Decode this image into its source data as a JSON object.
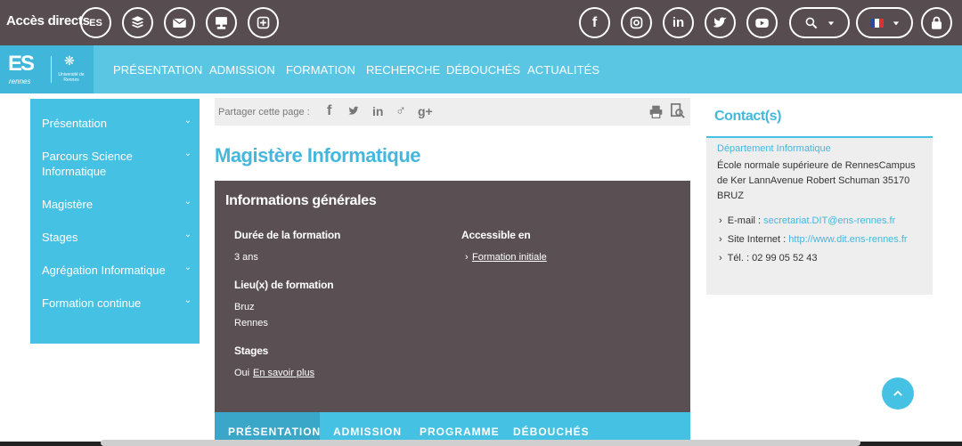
{
  "topbar": {
    "title": "Accès directs",
    "quick_icons": [
      "ens-icon",
      "book-icon",
      "mail-icon",
      "board-icon",
      "plus-box-icon"
    ],
    "ens_label": "ES",
    "social_icons": [
      "facebook-icon",
      "instagram-icon",
      "linkedin-icon",
      "twitter-icon",
      "youtube-icon"
    ],
    "social_labels": {
      "facebook": "f",
      "linkedin": "in"
    }
  },
  "navbar": {
    "logo_text": "ES",
    "logo_sub": "rennes",
    "univ_text": "Université de Rennes",
    "items": [
      "PRÉSENTATION",
      "ADMISSION",
      "FORMATION",
      "RECHERCHE",
      "DÉBOUCHÉS",
      "ACTUALITÉS"
    ]
  },
  "sidebar": {
    "items": [
      "Présentation",
      "Parcours Science Informatique",
      "Magistère",
      "Stages",
      "Agrégation Informatique",
      "Formation continue"
    ],
    "chevron": "⌄"
  },
  "share": {
    "label": "Partager cette page :",
    "icons": {
      "facebook": "f",
      "twitter": "🐦",
      "linkedin": "in",
      "viadeo": "♂",
      "googleplus": "g+"
    }
  },
  "main": {
    "title": "Magistère Informatique",
    "info": {
      "heading": "Informations générales",
      "duree_label": "Durée de la formation",
      "duree_value": "3 ans",
      "accessible_label": "Accessible en",
      "accessible_value": "Formation initiale",
      "accessible_bullet": "›",
      "lieu_label": "Lieu(x) de formation",
      "lieux": [
        "Bruz",
        "Rennes"
      ],
      "stages_label": "Stages",
      "stages_value": "Oui",
      "stages_link": "En savoir plus"
    },
    "tabs": [
      "PRÉSENTATION",
      "ADMISSION",
      "PROGRAMME",
      "DÉBOUCHÉS"
    ]
  },
  "contact": {
    "title": "Contact(s)",
    "department": "Département Informatique",
    "address": "École normale supérieure de RennesCampus de Ker LannAvenue Robert Schuman 35170 BRUZ",
    "email_label": "E-mail :",
    "email": "secretariat.DIT@ens-rennes.fr",
    "site_label": "Site Internet :",
    "site": "http://www.dit.ens-rennes.fr",
    "tel": "Tél. : 02 99 05 52 43",
    "bullet": "›"
  },
  "colors": {
    "accent": "#45c1e4",
    "dark": "#574c50",
    "title": "#45b7dd"
  }
}
